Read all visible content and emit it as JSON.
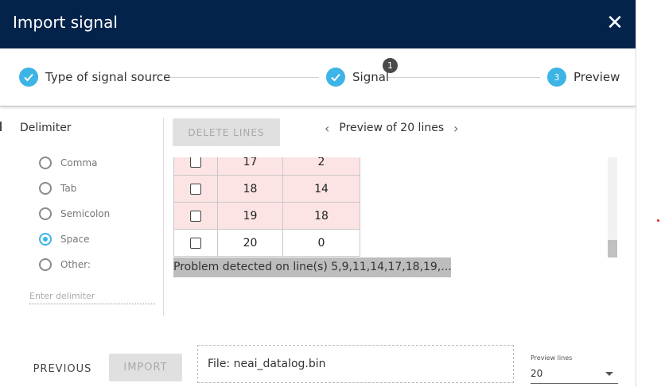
{
  "dialog": {
    "title": "Import signal",
    "close_label": "✕",
    "colors": {
      "header_bg": "#03234b",
      "accent": "#3cb4e6",
      "error_row": "#fde4e4"
    }
  },
  "stepper": {
    "steps": [
      {
        "label": "Type of signal source",
        "state": "done",
        "icon": "check-icon"
      },
      {
        "label": "Signal",
        "state": "done",
        "icon": "check-icon",
        "badge": "1"
      },
      {
        "label": "Preview",
        "state": "active",
        "number": "3"
      }
    ]
  },
  "delimiter": {
    "title": "Delimiter",
    "options": [
      {
        "label": "Comma",
        "selected": false
      },
      {
        "label": "Tab",
        "selected": false
      },
      {
        "label": "Semicolon",
        "selected": false
      },
      {
        "label": "Space",
        "selected": true
      },
      {
        "label": "Other:",
        "selected": false
      }
    ],
    "other_placeholder": "Enter delimiter",
    "other_value": ""
  },
  "preview": {
    "delete_button": "DELETE LINES",
    "prev_arrow": "‹",
    "next_arrow": "›",
    "title": "Preview of 20 lines",
    "rows": [
      {
        "c1": "17",
        "c2": "2",
        "error": true
      },
      {
        "c1": "18",
        "c2": "14",
        "error": true
      },
      {
        "c1": "19",
        "c2": "18",
        "error": true
      },
      {
        "c1": "20",
        "c2": "0",
        "error": false
      }
    ],
    "problem_text": "Problem detected on line(s) 5,9,11,14,17,18,19,..."
  },
  "footer": {
    "previous_label": "PREVIOUS",
    "import_label": "IMPORT",
    "file_label": "File: neai_datalog.bin",
    "preview_lines_label": "Preview lines",
    "preview_lines_value": "20"
  }
}
